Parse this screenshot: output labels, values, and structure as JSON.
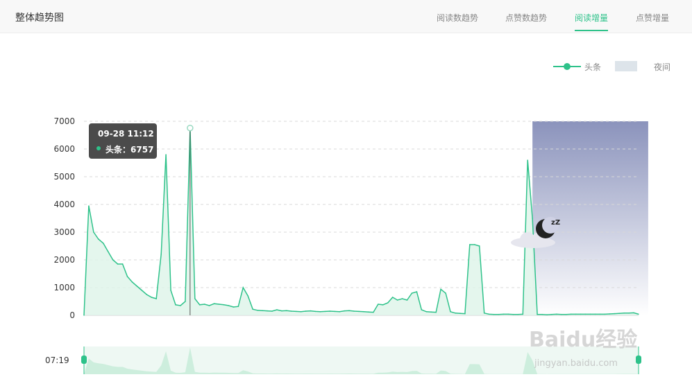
{
  "header": {
    "title": "整体趋势图",
    "tabs": [
      {
        "label": "阅读数趋势",
        "active": false
      },
      {
        "label": "点赞数趋势",
        "active": false
      },
      {
        "label": "阅读增量",
        "active": true
      },
      {
        "label": "点赞增量",
        "active": false
      }
    ]
  },
  "legend": {
    "series_label": "头条",
    "night_label": "夜间"
  },
  "tooltip": {
    "time": "09-28 11:12",
    "series": "头条",
    "value_text": "6757"
  },
  "slider": {
    "start_label": "07:19"
  },
  "colors": {
    "accent": "#2ec28a",
    "area": "#dff5ea",
    "night_top": "#8b93bc",
    "night_bottom": "#ffffff"
  },
  "watermark": "Baidu经验 jingyan.baidu.com",
  "chart_data": {
    "type": "area",
    "ylim": [
      0,
      7000
    ],
    "y_ticks": [
      0,
      1000,
      2000,
      3000,
      4000,
      5000,
      6000,
      7000
    ],
    "grid": true,
    "legend_position": "top-right",
    "series": [
      {
        "name": "头条",
        "values": [
          0,
          3950,
          3000,
          2750,
          2600,
          2300,
          2000,
          1850,
          1850,
          1400,
          1200,
          1050,
          900,
          750,
          650,
          600,
          2200,
          5800,
          900,
          380,
          350,
          500,
          6757,
          600,
          380,
          400,
          350,
          420,
          400,
          380,
          350,
          300,
          320,
          1000,
          700,
          220,
          180,
          170,
          160,
          150,
          200,
          160,
          170,
          150,
          140,
          130,
          150,
          160,
          140,
          130,
          140,
          150,
          140,
          130,
          160,
          170,
          150,
          140,
          130,
          120,
          110,
          400,
          380,
          450,
          650,
          550,
          600,
          550,
          800,
          850,
          200,
          130,
          120,
          110,
          940,
          800,
          130,
          80,
          70,
          60,
          2550,
          2550,
          2500,
          80,
          40,
          30,
          30,
          40,
          40,
          30,
          30,
          40,
          5600,
          3500,
          30,
          30,
          20,
          30,
          40,
          30,
          30,
          40,
          40,
          40,
          40,
          40,
          40,
          40,
          40,
          50,
          60,
          70,
          80,
          80,
          90,
          40
        ]
      }
    ],
    "night_band": {
      "start_index": 93,
      "end_index": 117
    }
  }
}
